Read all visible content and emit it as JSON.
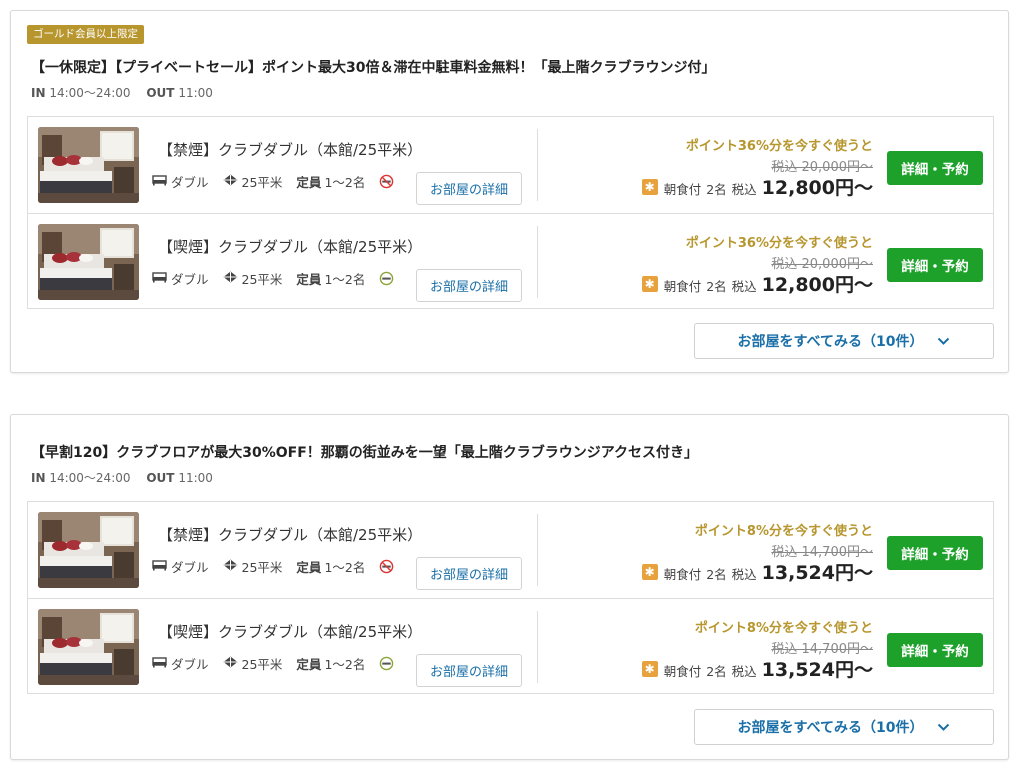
{
  "plans": [
    {
      "badge": "ゴールド会員以上限定",
      "title": "【一休限定】【プライベートセール】ポイント最大30倍＆滞在中駐車料金無料！「最上階クラブラウンジ付」",
      "checkin_label": "IN",
      "checkin_time": "14:00〜24:00",
      "checkout_label": "OUT",
      "checkout_time": "11:00",
      "rooms": [
        {
          "name": "【禁煙】クラブダブル（本館/25平米）",
          "bed": "ダブル",
          "size": "25平米",
          "capacity_label": "定員",
          "capacity": "1〜2名",
          "smoking": "no",
          "detail": "お部屋の詳細",
          "point_text": "ポイント36%分を今すぐ使うと",
          "old_price": "税込 20,000円〜",
          "meal": "朝食付",
          "guests": "2名",
          "tax_label": "税込",
          "price": "12,800円〜",
          "reserve": "詳細・予約"
        },
        {
          "name": "【喫煙】クラブダブル（本館/25平米）",
          "bed": "ダブル",
          "size": "25平米",
          "capacity_label": "定員",
          "capacity": "1〜2名",
          "smoking": "yes",
          "detail": "お部屋の詳細",
          "point_text": "ポイント36%分を今すぐ使うと",
          "old_price": "税込 20,000円〜",
          "meal": "朝食付",
          "guests": "2名",
          "tax_label": "税込",
          "price": "12,800円〜",
          "reserve": "詳細・予約"
        }
      ],
      "show_all": "お部屋をすべてみる（10件）"
    },
    {
      "title": "【早割120】クラブフロアが最大30%OFF！那覇の街並みを一望「最上階クラブラウンジアクセス付き」",
      "checkin_label": "IN",
      "checkin_time": "14:00〜24:00",
      "checkout_label": "OUT",
      "checkout_time": "11:00",
      "rooms": [
        {
          "name": "【禁煙】クラブダブル（本館/25平米）",
          "bed": "ダブル",
          "size": "25平米",
          "capacity_label": "定員",
          "capacity": "1〜2名",
          "smoking": "no",
          "detail": "お部屋の詳細",
          "point_text": "ポイント8%分を今すぐ使うと",
          "old_price": "税込 14,700円〜",
          "meal": "朝食付",
          "guests": "2名",
          "tax_label": "税込",
          "price": "13,524円〜",
          "reserve": "詳細・予約"
        },
        {
          "name": "【喫煙】クラブダブル（本館/25平米）",
          "bed": "ダブル",
          "size": "25平米",
          "capacity_label": "定員",
          "capacity": "1〜2名",
          "smoking": "yes",
          "detail": "お部屋の詳細",
          "point_text": "ポイント8%分を今すぐ使うと",
          "old_price": "税込 14,700円〜",
          "meal": "朝食付",
          "guests": "2名",
          "tax_label": "税込",
          "price": "13,524円〜",
          "reserve": "詳細・予約"
        }
      ],
      "show_all": "お部屋をすべてみる（10件）"
    }
  ],
  "colors": {
    "gold": "#b8962e",
    "reserve_green": "#1ea12b",
    "link_blue": "#1a6fa8",
    "meal_orange": "#e8a23d"
  }
}
